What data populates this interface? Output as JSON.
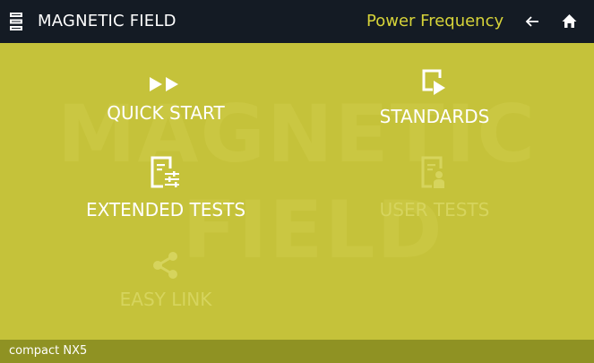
{
  "header": {
    "title": "MAGNETIC FIELD",
    "mode": "Power Frequency",
    "menu_icon": "list-menu-icon",
    "back_icon": "arrow-left-icon",
    "home_icon": "home-icon"
  },
  "watermark": {
    "line1": "MAGNETIC",
    "line2": "FIELD"
  },
  "tiles": [
    {
      "label": "QUICK START",
      "icon": "fast-forward-icon",
      "enabled": true
    },
    {
      "label": "STANDARDS",
      "icon": "document-play-icon",
      "enabled": true
    },
    {
      "label": "EXTENDED TESTS",
      "icon": "document-settings-icon",
      "enabled": true
    },
    {
      "label": "USER TESTS",
      "icon": "document-user-icon",
      "enabled": false
    },
    {
      "label": "EASY LINK",
      "icon": "share-icon",
      "enabled": false
    }
  ],
  "footer": {
    "device": "compact NX5"
  },
  "colors": {
    "background": "#c5c23a",
    "topbar": "#141b24",
    "accent": "#d6d339",
    "footer": "#8f9223",
    "disabled": "#d6d45d"
  }
}
